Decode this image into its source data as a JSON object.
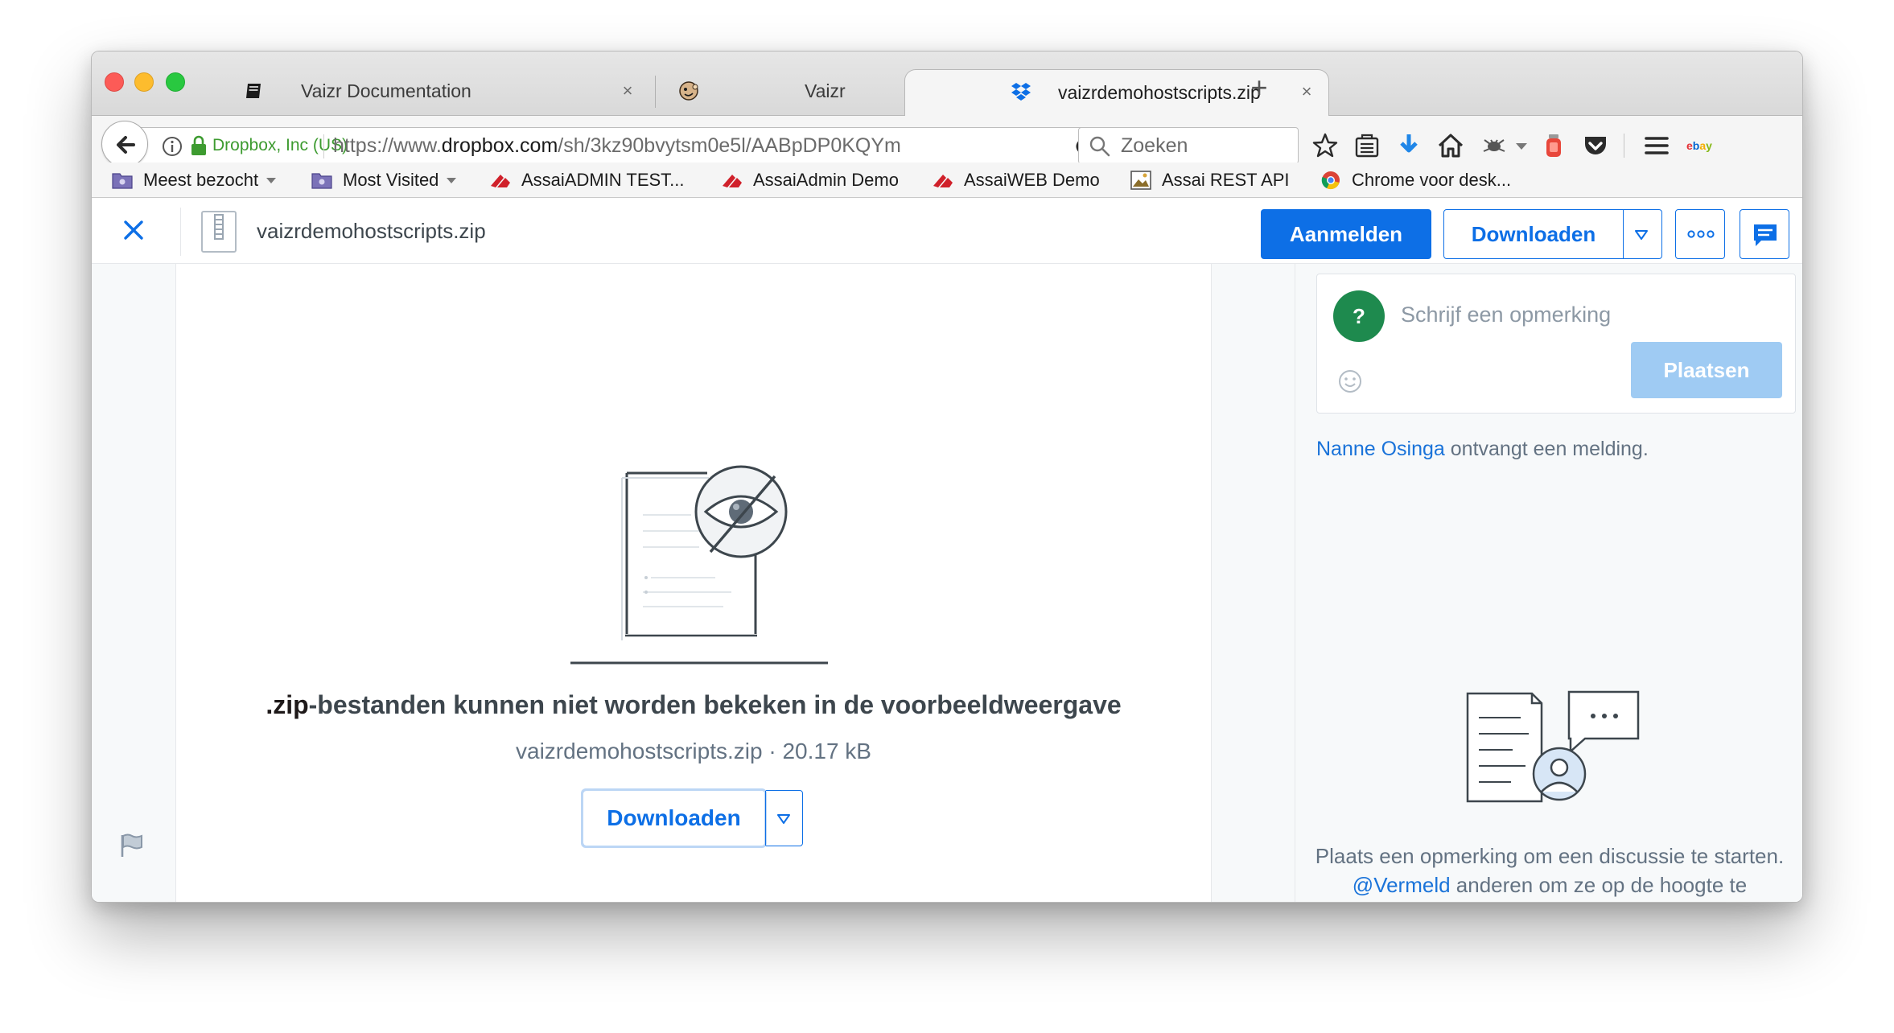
{
  "browser": {
    "tabs": [
      {
        "title": "Vaizr Documentation",
        "icon": "book-icon"
      },
      {
        "title": "Vaizr",
        "icon": "mailchimp-icon"
      },
      {
        "title": "vaizrdemohostscripts.zip",
        "icon": "dropbox-icon",
        "active": true
      }
    ],
    "url": {
      "identity": "Dropbox, Inc (US)",
      "prefix": "https://www.",
      "domain": "dropbox.com",
      "path": "/sh/3kz90bvytsm0e5l/AABpDP0KQYm"
    },
    "search_placeholder": "Zoeken",
    "bookmarks": [
      {
        "label": "Meest bezocht",
        "icon": "folder-icon",
        "dropdown": true
      },
      {
        "label": "Most Visited",
        "icon": "folder-icon",
        "dropdown": true
      },
      {
        "label": "AssaiADMIN TEST...",
        "icon": "assai-icon"
      },
      {
        "label": "AssaiAdmin Demo",
        "icon": "assai-icon"
      },
      {
        "label": "AssaiWEB Demo",
        "icon": "assai-icon"
      },
      {
        "label": "Assai REST API",
        "icon": "image-icon"
      },
      {
        "label": "Chrome voor desk...",
        "icon": "chrome-icon"
      }
    ]
  },
  "header": {
    "filename": "vaizrdemohostscripts.zip",
    "signin_label": "Aanmelden",
    "download_label": "Downloaden"
  },
  "preview": {
    "ext": ".zip",
    "message_rest": "-bestanden kunnen niet worden bekeken in de voorbeeldweergave",
    "meta": "vaizrdemohostscripts.zip · 20.17 kB",
    "download_label": "Downloaden"
  },
  "comments": {
    "avatar_letter": "?",
    "placeholder": "Schrijf een opmerking",
    "post_label": "Plaatsen",
    "notify_name": "Nanne Osinga",
    "notify_rest": " ontvangt een melding.",
    "empty_text_1": "Plaats een opmerking om een discussie te starten. ",
    "empty_link": "@Vermeld",
    "empty_text_2": " anderen om ze op de hoogte te brengen."
  },
  "colors": {
    "accent": "#0d6fe6",
    "avatar": "#1e8a4e",
    "secure": "#3d9b30",
    "post_disabled": "#9fcbf3"
  }
}
